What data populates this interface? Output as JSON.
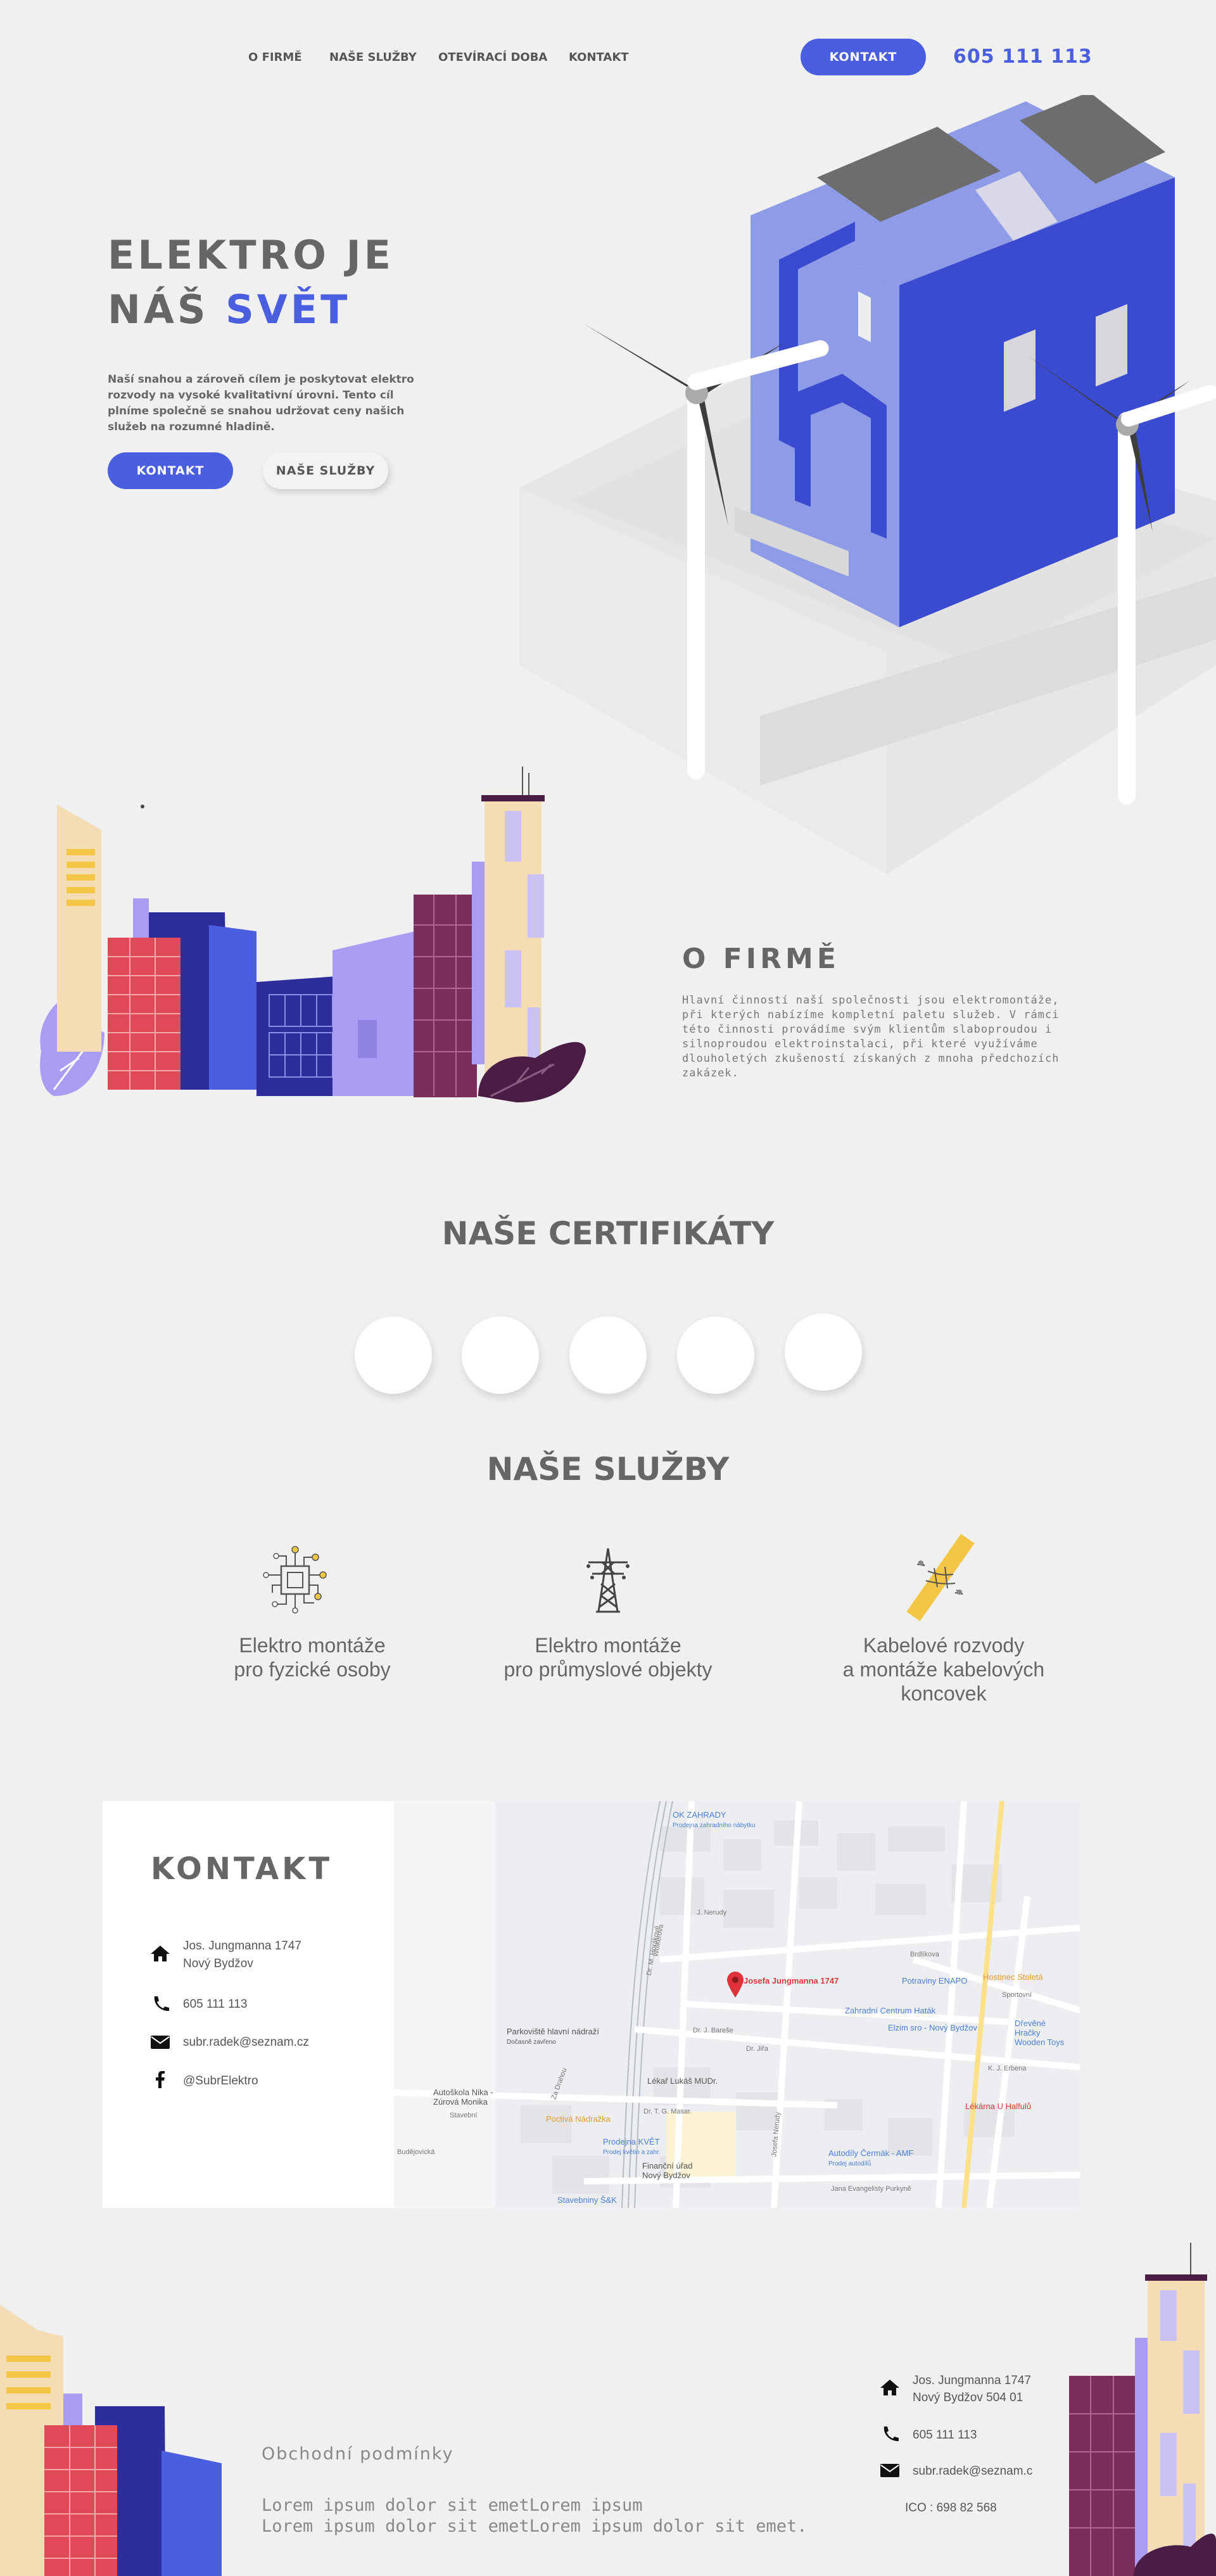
{
  "nav": {
    "items": [
      {
        "label": "O FIRMĚ"
      },
      {
        "label": "NAŠE SLUŽBY"
      },
      {
        "label": "OTEVÍRACÍ DOBA"
      },
      {
        "label": "KONTAKT"
      }
    ],
    "cta_label": "KONTAKT",
    "phone": "605 111 113"
  },
  "hero": {
    "title_line1": "ELEKTRO JE",
    "title_line2_a": "NÁŠ",
    "title_line2_b": "SVĚT",
    "text": "Naší snahou a zároveň cílem je poskytovat elektro rozvody na vysoké kvalitativní úrovni. Tento cíl plníme společně se snahou udržovat ceny našich služeb na rozumné hladině.",
    "primary_button": "KONTAKT",
    "secondary_button": "NAŠE SLUŽBY"
  },
  "about": {
    "title": "O FIRMĚ",
    "text": "Hlavní činností naší společnosti jsou elektromontáže, při kterých nabízíme kompletní paletu služeb. V rámci této činnosti provádíme svým klientům slaboproudou i silnoproudou elektroinstalaci, při které využíváme dlouholetých zkušeností získaných z mnoha předchozích zakázek."
  },
  "certificates": {
    "title": "NAŠE CERTIFIKÁTY",
    "count": 5
  },
  "services": {
    "title": "NAŠE SLUŽBY",
    "items": [
      {
        "line1": "Elektro montáže",
        "line2": "pro fyzické osoby",
        "line3": "",
        "icon": "circuit-chip-icon"
      },
      {
        "line1": "Elektro montáže",
        "line2": "pro průmyslové objekty",
        "line3": "",
        "icon": "power-tower-icon"
      },
      {
        "line1": "Kabelové rozvody",
        "line2": "a montáže kabelových",
        "line3": "koncovek",
        "icon": "cable-splice-icon"
      }
    ]
  },
  "contact": {
    "title": "KONTAKT",
    "address_line1": "Jos. Jungmanna 1747",
    "address_line2": "Nový Bydžov",
    "phone": "605 111 113",
    "email": "subr.radek@seznam.cz",
    "facebook": "@SubrElektro"
  },
  "map": {
    "pin_label": "Josefa Jungmanna 1747",
    "places": [
      {
        "name": "OK ZAHRADY",
        "sub": "Prodejna zahradního nábytku",
        "color": "#4a7fd8"
      },
      {
        "name": "Potraviny ENAPO",
        "sub": "",
        "color": "#4a7fd8"
      },
      {
        "name": "Hostinec Stoletá",
        "sub": "",
        "color": "#e59a2a"
      },
      {
        "name": "Zahradní Centrum Haták",
        "sub": "",
        "color": "#4a7fd8"
      },
      {
        "name": "Elzim sro - Nový Bydžov",
        "sub": "",
        "color": "#4a7fd8"
      },
      {
        "name": "Dřevěné Hračky Wooden Toys",
        "sub": "",
        "color": "#4a7fd8"
      },
      {
        "name": "Parkoviště hlavní nádraží",
        "sub": "Dočasně zavřeno",
        "color": "#555"
      },
      {
        "name": "Autoškola Nika - Zúrová Monika",
        "sub": "",
        "color": "#555"
      },
      {
        "name": "Lékař Lukáš MUDr.",
        "sub": "",
        "color": "#555"
      },
      {
        "name": "Poctivá Nádražka",
        "sub": "",
        "color": "#e59a2a"
      },
      {
        "name": "Lékárna U Halfulů",
        "sub": "",
        "color": "#d93b3b"
      },
      {
        "name": "Prodejna KVĚT",
        "sub": "Prodej květin a zahr.",
        "color": "#4a7fd8"
      },
      {
        "name": "Finanční úřad Nový Bydžov",
        "sub": "",
        "color": "#555"
      },
      {
        "name": "Autodíly Čermák - AMF",
        "sub": "Prodej autodílů",
        "color": "#4a7fd8"
      },
      {
        "name": "Stavebniny Š&K",
        "sub": "",
        "color": "#4a7fd8"
      }
    ],
    "streets": [
      "J. Nerudy",
      "Dr. M. Horákové",
      "Wolkerova",
      "Dr. J. Bareše",
      "Dr. Jiřa",
      "Dr. T. G. Masar.",
      "Josefa Nerudy",
      "Jana Evangelisty Purkyně",
      "Stavební",
      "K. J. Erbena",
      "Sportovní",
      "Budějovická",
      "Brdlíkova",
      "Za Drahou"
    ]
  },
  "footer": {
    "terms": "Obchodní podmínky",
    "lorem_line1": "Lorem ipsum dolor sit emetLorem ipsum",
    "lorem_line2": "Lorem ipsum dolor sit emetLorem ipsum dolor sit emet.",
    "address_line1": "Jos. Jungmanna 1747",
    "address_line2": "Nový Bydžov 504 01",
    "phone": "605 111 113",
    "email": "subr.radek@seznam.c",
    "ico": "ICO : 698 82 568"
  },
  "colors": {
    "accent": "#4a5ee0",
    "background": "#f0f0f0",
    "text": "#666666"
  }
}
